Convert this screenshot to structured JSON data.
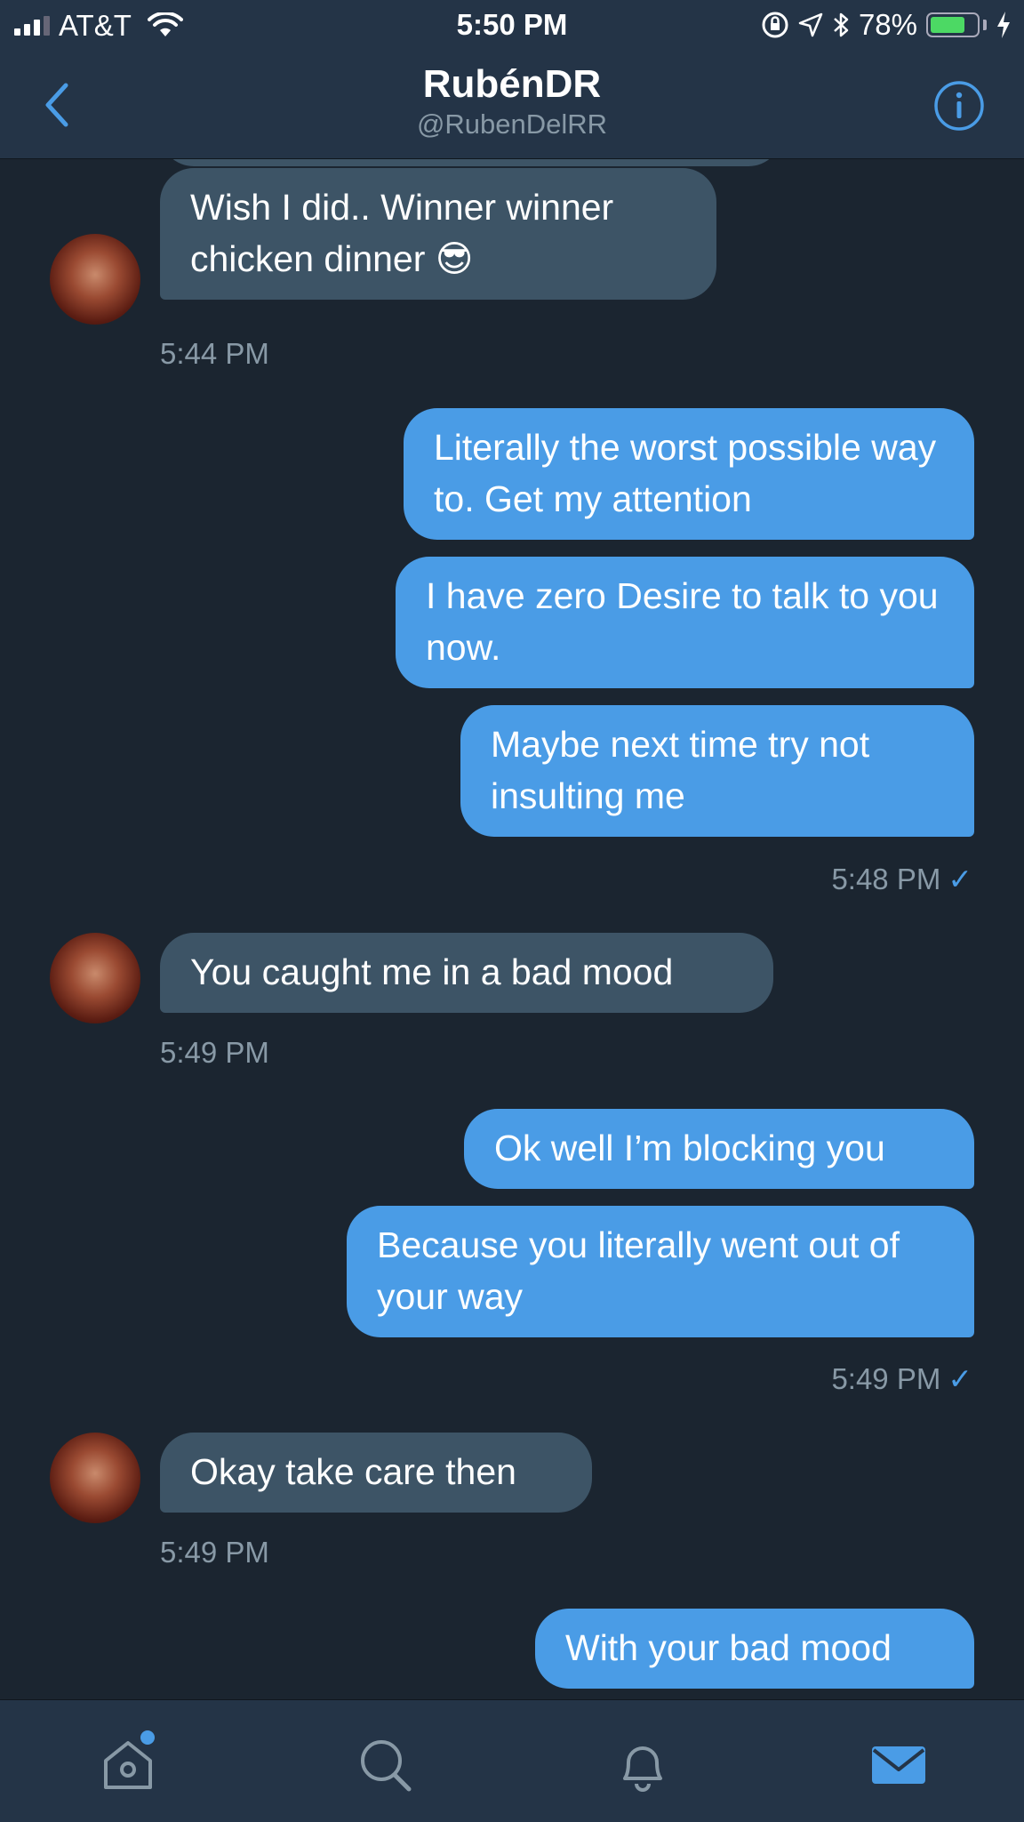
{
  "status_bar": {
    "carrier": "AT&T",
    "time": "5:50 PM",
    "battery_percent": "78%",
    "battery_level": 0.78,
    "icons": [
      "signal-icon",
      "wifi-icon",
      "rotation-lock-icon",
      "location-icon",
      "bluetooth-icon",
      "battery-icon",
      "charging-icon"
    ]
  },
  "header": {
    "title": "RubénDR",
    "handle": "@RubenDelRR",
    "back_icon": "chevron-left-icon",
    "info_icon": "info-icon"
  },
  "messages": [
    {
      "direction": "incoming",
      "text": "Wish I did.. Winner winner chicken dinner 😎"
    },
    {
      "timestamp": "5:44 PM",
      "direction": "incoming"
    },
    {
      "direction": "outgoing",
      "text": "Literally the worst possible way to. Get my attention"
    },
    {
      "direction": "outgoing",
      "text": "I have zero Desire to talk to you now."
    },
    {
      "direction": "outgoing",
      "text": "Maybe next time try not insulting me"
    },
    {
      "timestamp": "5:48 PM",
      "direction": "outgoing",
      "read": "✓"
    },
    {
      "direction": "incoming",
      "text": "You caught me in a bad mood"
    },
    {
      "timestamp": "5:49 PM",
      "direction": "incoming"
    },
    {
      "direction": "outgoing",
      "text": "Ok well I’m blocking you"
    },
    {
      "direction": "outgoing",
      "text": "Because you literally went out of your way"
    },
    {
      "timestamp": "5:49 PM",
      "direction": "outgoing",
      "read": "✓"
    },
    {
      "direction": "incoming",
      "text": "Okay take care then"
    },
    {
      "timestamp": "5:49 PM",
      "direction": "incoming"
    },
    {
      "direction": "outgoing",
      "text": "With your bad mood"
    }
  ],
  "tab_bar": {
    "tabs": [
      {
        "icon": "home-icon",
        "active": false,
        "has_badge": true
      },
      {
        "icon": "search-icon",
        "active": false
      },
      {
        "icon": "bell-icon",
        "active": false
      },
      {
        "icon": "mail-icon",
        "active": true
      }
    ]
  },
  "colors": {
    "background": "#1b2530",
    "bar": "#243447",
    "incoming_bubble": "#3d5466",
    "outgoing_bubble": "#4a9ce6",
    "muted_text": "#8899a6",
    "accent": "#4a9ce6"
  }
}
